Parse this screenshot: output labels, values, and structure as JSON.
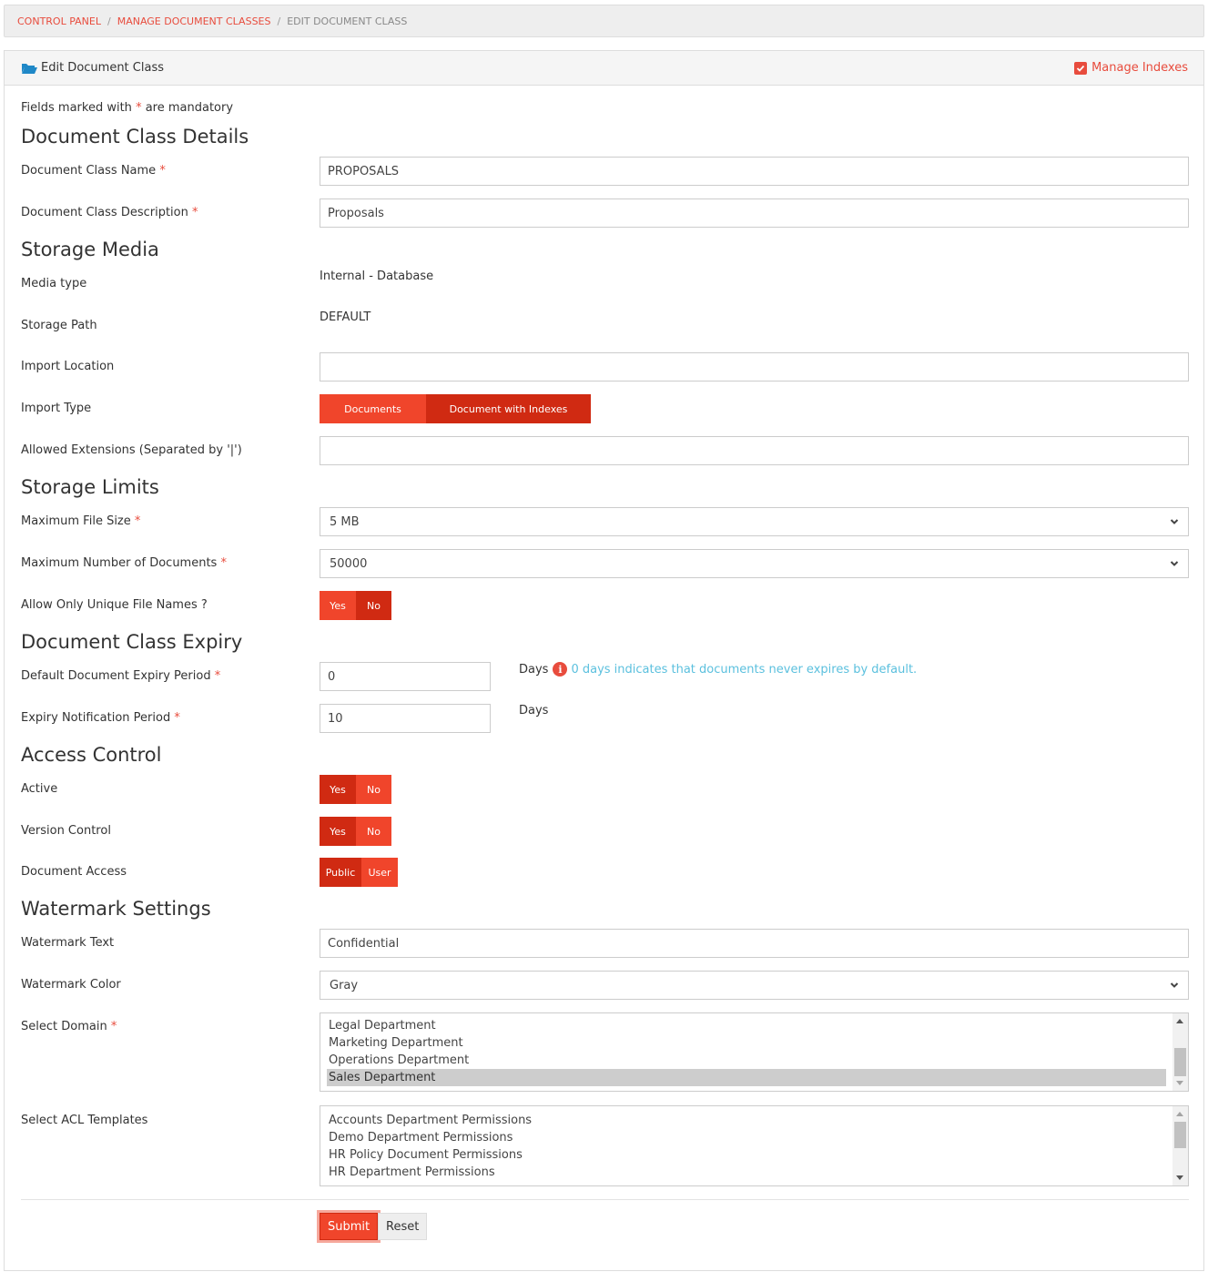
{
  "breadcrumb": {
    "items": [
      "CONTROL PANEL",
      "MANAGE DOCUMENT CLASSES"
    ],
    "current": "EDIT DOCUMENT CLASS",
    "separator": "/"
  },
  "panel": {
    "title": "Edit Document Class",
    "manage_indexes_label": "Manage Indexes",
    "manage_indexes_checked": true
  },
  "form": {
    "mandatory_note_prefix": "Fields marked with",
    "mandatory_note_star": "*",
    "mandatory_note_suffix": "are mandatory",
    "sections": {
      "details": "Document Class Details",
      "storage_media": "Storage Media",
      "storage_limits": "Storage Limits",
      "expiry": "Document Class Expiry",
      "access_control": "Access Control",
      "watermark": "Watermark Settings"
    },
    "fields": {
      "class_name": {
        "label": "Document Class Name",
        "value": "PROPOSALS",
        "required": true
      },
      "class_description": {
        "label": "Document Class Description",
        "value": "Proposals",
        "required": true
      },
      "media_type": {
        "label": "Media type",
        "value": "Internal - Database"
      },
      "storage_path": {
        "label": "Storage Path",
        "value": "DEFAULT"
      },
      "import_location": {
        "label": "Import Location",
        "value": ""
      },
      "import_type": {
        "label": "Import Type",
        "options": [
          "Documents",
          "Document with Indexes"
        ],
        "selected": "Document with Indexes"
      },
      "allowed_extensions": {
        "label": "Allowed Extensions (Separated by '|')",
        "value": ""
      },
      "max_file_size": {
        "label": "Maximum File Size",
        "value": "5 MB",
        "required": true
      },
      "max_documents": {
        "label": "Maximum Number of Documents",
        "value": "50000",
        "required": true
      },
      "unique_file_names": {
        "label": "Allow Only Unique File Names ?",
        "options": [
          "Yes",
          "No"
        ],
        "selected": "No"
      },
      "expiry_period": {
        "label": "Default Document Expiry Period",
        "value": "0",
        "unit": "Days",
        "required": true,
        "info": "0 days indicates that documents never expires by default."
      },
      "notification_period": {
        "label": "Expiry Notification Period",
        "value": "10",
        "unit": "Days",
        "required": true
      },
      "active": {
        "label": "Active",
        "options": [
          "Yes",
          "No"
        ],
        "selected": "Yes"
      },
      "version_control": {
        "label": "Version Control",
        "options": [
          "Yes",
          "No"
        ],
        "selected": "Yes"
      },
      "document_access": {
        "label": "Document Access",
        "options": [
          "Public",
          "User"
        ],
        "selected": "Public"
      },
      "watermark_text": {
        "label": "Watermark Text",
        "value": "Confidential"
      },
      "watermark_color": {
        "label": "Watermark Color",
        "value": "Gray"
      },
      "select_domain": {
        "label": "Select Domain",
        "required": true,
        "options": [
          "Legal Department",
          "Marketing Department",
          "Operations Department",
          "Sales Department"
        ],
        "selected": "Sales Department"
      },
      "acl_templates": {
        "label": "Select ACL Templates",
        "options": [
          "Accounts Department Permissions",
          "Demo Department Permissions",
          "HR Policy Document Permissions",
          "HR Department Permissions"
        ]
      }
    },
    "buttons": {
      "submit": "Submit",
      "reset": "Reset"
    }
  },
  "colors": {
    "accent": "#f0452b",
    "accent_active": "#d02a12",
    "link": "#e84c3d",
    "info_text": "#5bc0de",
    "folder_icon": "#1f88c7"
  }
}
